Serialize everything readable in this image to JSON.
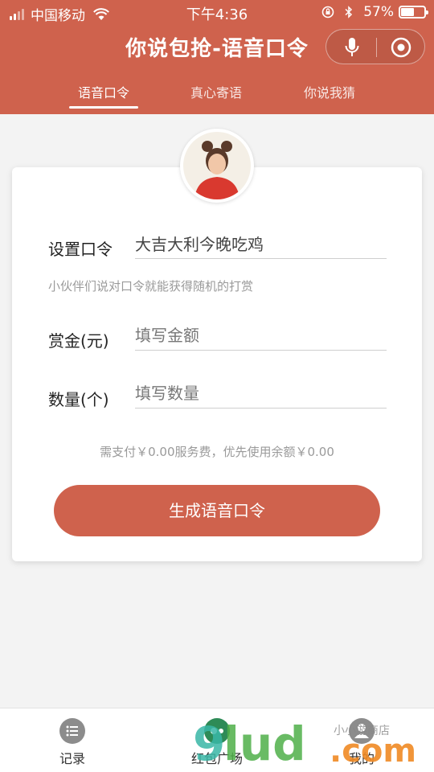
{
  "status_bar": {
    "carrier": "中国移动",
    "time": "下午4:36",
    "battery": "57%",
    "battery_level": 0.57
  },
  "nav": {
    "title": "你说包抢-语音口令",
    "capsule_icons": [
      "microphone-icon",
      "target-icon"
    ]
  },
  "tabs": [
    {
      "label": "语音口令",
      "active": true
    },
    {
      "label": "真心寄语",
      "active": false
    },
    {
      "label": "你说我猜",
      "active": false
    }
  ],
  "form": {
    "command_label": "设置口令",
    "command_value": "大吉大利今晚吃鸡",
    "hint": "小伙伴们说对口令就能获得随机的打赏",
    "amount_label": "赏金(元)",
    "amount_placeholder": "填写金额",
    "count_label": "数量(个)",
    "count_placeholder": "填写数量",
    "fee_text": "需支付￥0.00服务费，优先使用余额￥0.00",
    "submit_label": "生成语音口令"
  },
  "tabbar": {
    "items": [
      {
        "label": "记录",
        "icon": "list-icon"
      },
      {
        "label": "红包广场",
        "icon": "plaza-icon"
      },
      {
        "label": "我的",
        "icon": "user-icon"
      }
    ]
  },
  "colors": {
    "accent": "#cf624d",
    "background": "#f3f3f3"
  },
  "watermark": {
    "logo_text": "9lud.com",
    "caption": "小小游商店"
  }
}
